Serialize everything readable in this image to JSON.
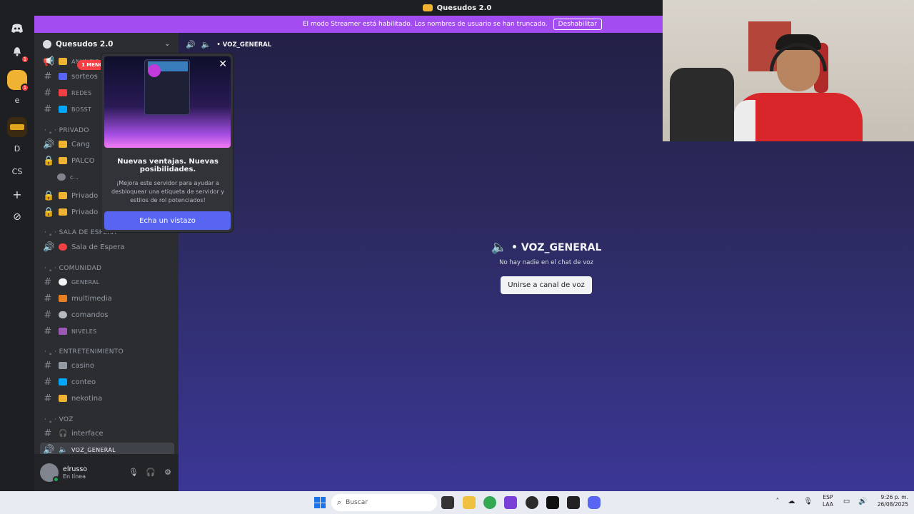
{
  "window": {
    "title": "Quesudos 2.0"
  },
  "streamer_bar": {
    "message": "El modo Streamer está habilitado. Los nombres de usuario se han truncado.",
    "disable_label": "Deshabilitar"
  },
  "guilds": {
    "items": [
      {
        "label": "",
        "icon": "discord-icon"
      },
      {
        "label": "",
        "icon": "bell-icon",
        "badge": "1"
      },
      {
        "label": "",
        "icon": "server-quesudos",
        "badge": "1"
      },
      {
        "label": "e",
        "icon": ""
      },
      {
        "label": "",
        "icon": "server-logo"
      },
      {
        "label": "D",
        "icon": ""
      },
      {
        "label": "CS",
        "icon": ""
      },
      {
        "label": "+",
        "icon": "add-server-icon"
      },
      {
        "label": "⊘",
        "icon": "explore-icon"
      }
    ]
  },
  "sidebar": {
    "server_name": "Quesudos 2.0",
    "mention_badge": "1 MENC",
    "channels": [
      {
        "name": "ANUNCIO",
        "type": "announcement",
        "small": true
      },
      {
        "name": "sorteos",
        "type": "text"
      },
      {
        "name": "REDES",
        "type": "text",
        "small": true
      },
      {
        "name": "BOSST",
        "type": "text",
        "small": true
      },
      {
        "name": "Cang",
        "type": "voice"
      },
      {
        "name": "PALCO",
        "type": "locked"
      },
      {
        "name": "c...",
        "type": "sub"
      },
      {
        "name": "Privado",
        "type": "locked"
      },
      {
        "name": "Privado",
        "type": "locked"
      },
      {
        "name": "Sala de Espera",
        "type": "voice"
      },
      {
        "name": "GENERAL",
        "type": "text",
        "small": true
      },
      {
        "name": "multimedia",
        "type": "text"
      },
      {
        "name": "comandos",
        "type": "text"
      },
      {
        "name": "NIVELES",
        "type": "text",
        "small": true
      },
      {
        "name": "casino",
        "type": "text"
      },
      {
        "name": "conteo",
        "type": "text"
      },
      {
        "name": "nekotina",
        "type": "text"
      },
      {
        "name": "interface",
        "type": "voice"
      },
      {
        "name": "VOZ_GENERAL",
        "type": "voice",
        "active": true
      }
    ],
    "categories": [
      "PRIVADO",
      "SALA DE ESPERA",
      "COMUNIDAD",
      "ENTRETENIMIENTO",
      "VOZ"
    ]
  },
  "user_panel": {
    "username": "elrusso",
    "status": "En línea"
  },
  "main": {
    "header_channel": "• VOZ_GENERAL",
    "voice_title": "• VOZ_GENERAL",
    "empty_text": "No hay nadie en el chat de voz",
    "join_label": "Unirse a canal de voz"
  },
  "popup": {
    "heading": "Nuevas ventajas. Nuevas posibilidades.",
    "body": "¡Mejora este servidor para ayudar a desbloquear una etiqueta de servidor y estilos de rol potenciados!",
    "cta_label": "Echa un vistazo"
  },
  "taskbar": {
    "search_placeholder": "Buscar",
    "lang_top": "ESP",
    "lang_bottom": "LAA",
    "time": "9:26 p. m.",
    "date": "26/08/2025"
  },
  "colors": {
    "accent": "#5865f2",
    "streamer_bar": "#a34cf0",
    "status_online": "#23a55a",
    "badge": "#f23f43"
  }
}
